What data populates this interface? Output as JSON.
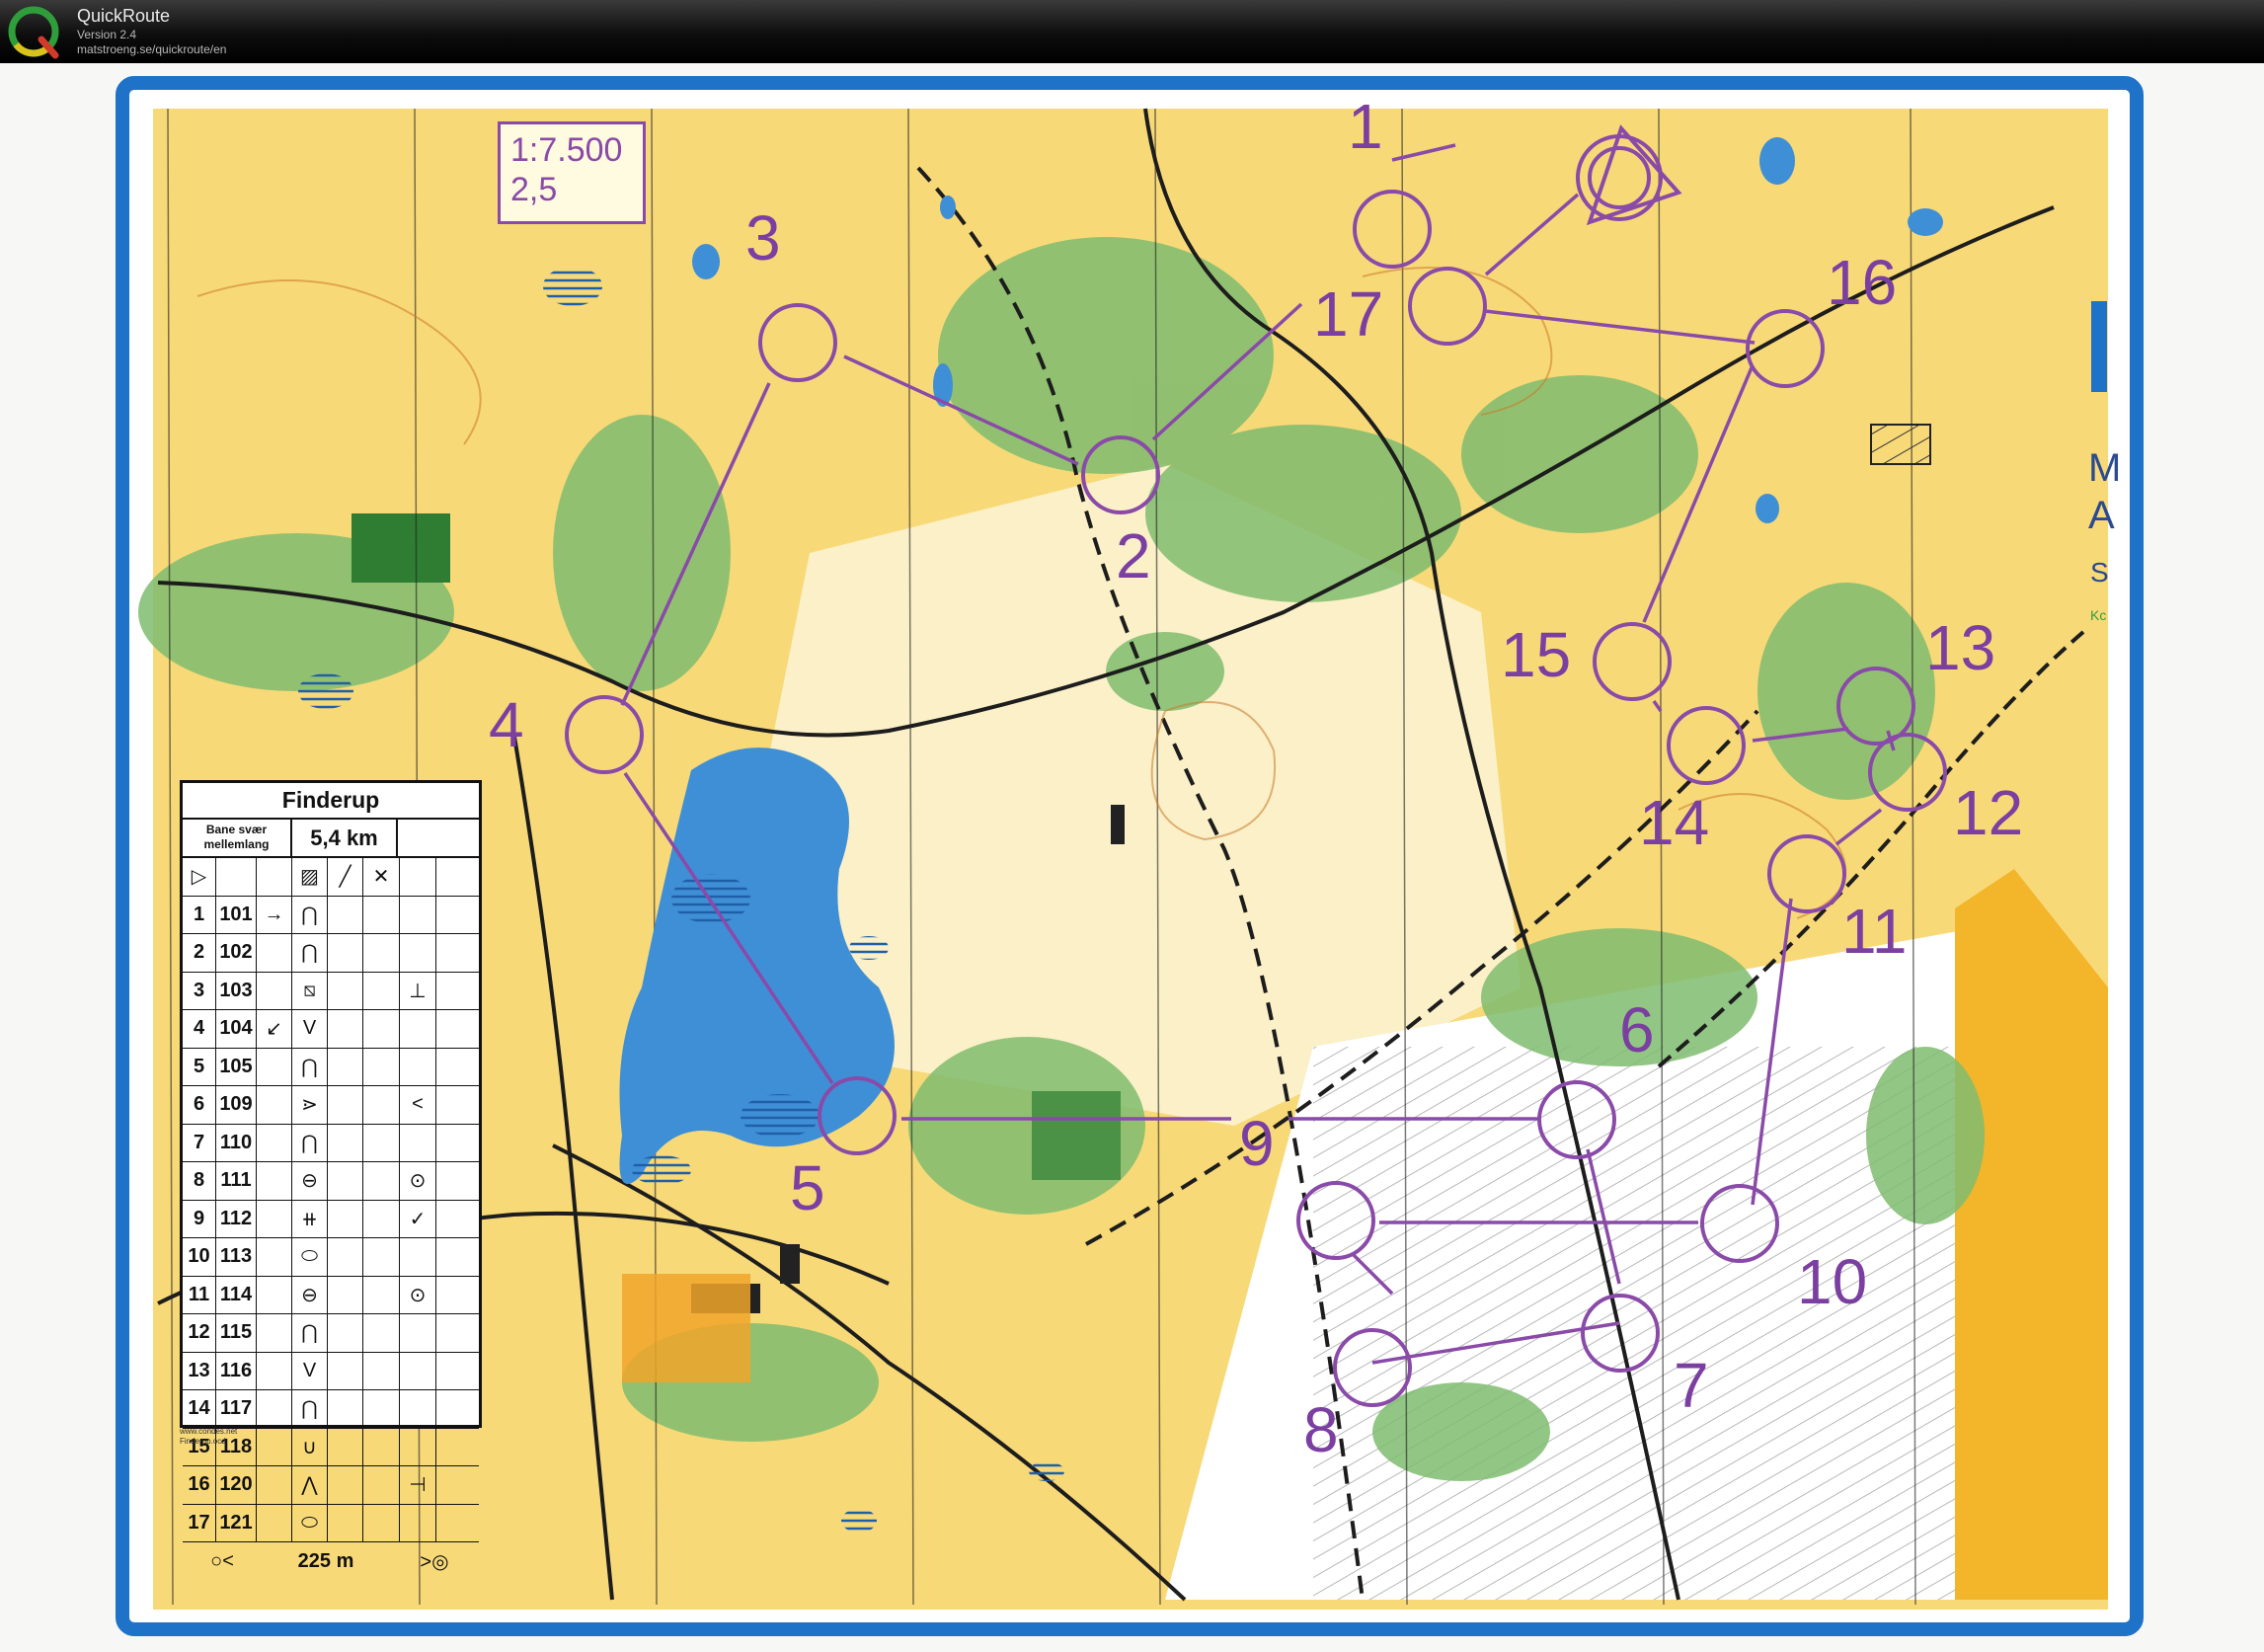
{
  "app": {
    "name": "QuickRoute",
    "version": "Version 2.4",
    "url": "matstroeng.se/quickroute/en",
    "logo_letter": "Q"
  },
  "map": {
    "scale_line1": "1:7.500",
    "scale_line2": "2,5",
    "edge_letters": [
      "M",
      "A",
      "S",
      "Kc"
    ],
    "controls": [
      {
        "label": "1"
      },
      {
        "label": "2"
      },
      {
        "label": "3"
      },
      {
        "label": "4"
      },
      {
        "label": "5"
      },
      {
        "label": "6"
      },
      {
        "label": "7"
      },
      {
        "label": "8"
      },
      {
        "label": "9"
      },
      {
        "label": "10"
      },
      {
        "label": "11"
      },
      {
        "label": "12"
      },
      {
        "label": "13"
      },
      {
        "label": "14"
      },
      {
        "label": "15"
      },
      {
        "label": "16"
      },
      {
        "label": "17"
      }
    ],
    "credit_line1": "www.condes.net",
    "credit_line2": "Finderup.ocd"
  },
  "descriptions": {
    "title": "Finderup",
    "course_line1": "Bane svær",
    "course_line2": "mellemlang",
    "length": "5,4 km",
    "rows": [
      {
        "n": "1",
        "code": "101",
        "dir": "→",
        "feature": "⋂",
        "extra": ""
      },
      {
        "n": "2",
        "code": "102",
        "dir": "",
        "feature": "⋂",
        "extra": ""
      },
      {
        "n": "3",
        "code": "103",
        "dir": "",
        "feature": "⧅",
        "extra": "⊥"
      },
      {
        "n": "4",
        "code": "104",
        "dir": "↙",
        "feature": "V",
        "extra": ""
      },
      {
        "n": "5",
        "code": "105",
        "dir": "",
        "feature": "⋂",
        "extra": ""
      },
      {
        "n": "6",
        "code": "109",
        "dir": "",
        "feature": "⋗",
        "extra": "<"
      },
      {
        "n": "7",
        "code": "110",
        "dir": "",
        "feature": "⋂",
        "extra": ""
      },
      {
        "n": "8",
        "code": "111",
        "dir": "",
        "feature": "⊖",
        "extra": "⊙"
      },
      {
        "n": "9",
        "code": "112",
        "dir": "",
        "feature": "⧺",
        "extra": "✓"
      },
      {
        "n": "10",
        "code": "113",
        "dir": "",
        "feature": "⬭",
        "extra": ""
      },
      {
        "n": "11",
        "code": "114",
        "dir": "",
        "feature": "⊖",
        "extra": "⊙"
      },
      {
        "n": "12",
        "code": "115",
        "dir": "",
        "feature": "⋂",
        "extra": ""
      },
      {
        "n": "13",
        "code": "116",
        "dir": "",
        "feature": "V",
        "extra": ""
      },
      {
        "n": "14",
        "code": "117",
        "dir": "",
        "feature": "⋂",
        "extra": ""
      },
      {
        "n": "15",
        "code": "118",
        "dir": "",
        "feature": "∪",
        "extra": ""
      },
      {
        "n": "16",
        "code": "120",
        "dir": "",
        "feature": "⋀",
        "extra": "⊣"
      },
      {
        "n": "17",
        "code": "121",
        "dir": "",
        "feature": "⬭",
        "extra": ""
      }
    ],
    "footer_start": "○<",
    "footer_distance": "225 m",
    "footer_finish": ">◎"
  },
  "colors": {
    "course": "#8a4aa8",
    "open_land": "#f8d978",
    "forest": "#fbfbf2",
    "green": "#79b56a",
    "water": "#3f8fd6",
    "frame": "#1e73c8"
  }
}
